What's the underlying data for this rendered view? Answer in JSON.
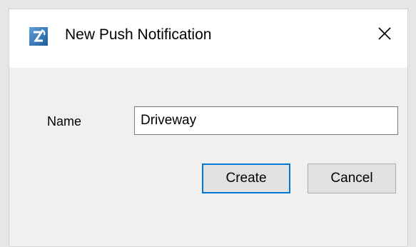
{
  "window": {
    "title": "New Push Notification",
    "icon": "app-logo-icon",
    "close_icon": "close-icon"
  },
  "form": {
    "name_label": "Name",
    "name_value": "Driveway"
  },
  "buttons": {
    "create_label": "Create",
    "cancel_label": "Cancel"
  },
  "colors": {
    "focus_border": "#0078d7",
    "dialog_background": "#f0f0f0",
    "titlebar_background": "#ffffff"
  }
}
